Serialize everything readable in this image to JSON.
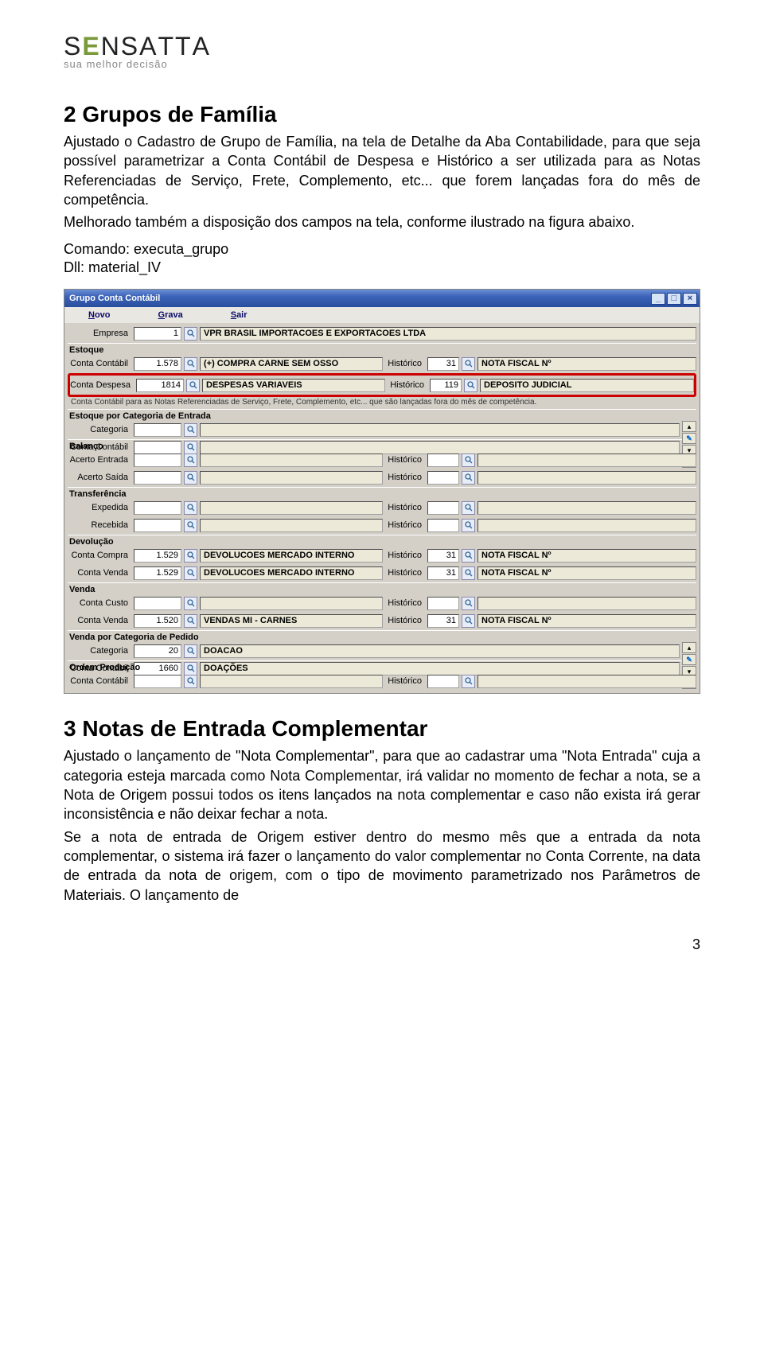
{
  "logo": {
    "brand": "SENSATTA",
    "tagline": "sua melhor decisão"
  },
  "section2": {
    "heading": "2  Grupos de Família",
    "p1": "Ajustado o Cadastro de Grupo de Família, na tela de Detalhe da Aba Contabilidade, para que seja possível parametrizar a Conta Contábil de Despesa e Histórico a ser utilizada para as Notas Referenciadas de Serviço, Frete, Complemento, etc... que forem lançadas fora do mês de competência.",
    "p2": "Melhorado também a disposição dos campos na tela, conforme ilustrado na figura abaixo.",
    "cmd": "Comando: executa_grupo",
    "dll": "Dll: material_IV"
  },
  "app": {
    "title": "Grupo Conta Contábil",
    "menu": {
      "novo": "Novo",
      "grava": "Grava",
      "sair": "Sair"
    },
    "empresa": {
      "label": "Empresa",
      "code": "1",
      "name": "VPR BRASIL IMPORTACOES E EXPORTACOES LTDA"
    },
    "estoque": {
      "title": "Estoque",
      "conta_label": "Conta Contábil",
      "conta_code": "1.578",
      "conta_name": "(+) COMPRA CARNE SEM OSSO",
      "hist_label": "Histórico",
      "hist_code": "31",
      "hist_name": "NOTA FISCAL Nº"
    },
    "despesa": {
      "label": "Conta Despesa",
      "code": "1814",
      "name": "DESPESAS VARIAVEIS",
      "hist_label": "Histórico",
      "hist_code": "119",
      "hist_name": "DEPOSITO JUDICIAL"
    },
    "note": "Conta Contábil para as Notas Referenciadas de Serviço, Frete, Complemento, etc... que são lançadas fora do mês de competência.",
    "estoque_cat": {
      "title": "Estoque por Categoria de Entrada",
      "categoria_label": "Categoria",
      "conta_label": "Conta Contábil"
    },
    "balanco": {
      "title": "Balanço",
      "entrada_label": "Acerto Entrada",
      "saida_label": "Acerto Saída",
      "hist_label": "Histórico"
    },
    "transf": {
      "title": "Transferência",
      "exp_label": "Expedida",
      "rec_label": "Recebida",
      "hist_label": "Histórico"
    },
    "devol": {
      "title": "Devolução",
      "compra_label": "Conta Compra",
      "compra_code": "1.529",
      "compra_name": "DEVOLUCOES MERCADO INTERNO",
      "venda_label": "Conta Venda",
      "venda_code": "1.529",
      "venda_name": "DEVOLUCOES MERCADO INTERNO",
      "hist_label": "Histórico",
      "hist_code": "31",
      "hist_name": "NOTA FISCAL Nº"
    },
    "venda": {
      "title": "Venda",
      "custo_label": "Conta Custo",
      "venda_label": "Conta Venda",
      "venda_code": "1.520",
      "venda_name": "VENDAS MI - CARNES",
      "hist_label": "Histórico",
      "hist_code": "31",
      "hist_name": "NOTA FISCAL Nº"
    },
    "venda_cat": {
      "title": "Venda por Categoria de Pedido",
      "categoria_label": "Categoria",
      "categoria_code": "20",
      "categoria_name": "DOACAO",
      "conta_label": "Conta Contábil",
      "conta_code": "1660",
      "conta_name": "DOAÇÕES"
    },
    "ordem": {
      "title": "Ordem Produção",
      "conta_label": "Conta Contábil",
      "hist_label": "Histórico"
    }
  },
  "section3": {
    "heading": "3  Notas de Entrada Complementar",
    "p1": "Ajustado o lançamento de \"Nota Complementar\", para que ao cadastrar uma \"Nota Entrada\" cuja a categoria esteja marcada como Nota Complementar, irá validar no momento de fechar a nota, se a Nota de Origem possui todos os itens lançados na nota complementar e caso não exista irá gerar inconsistência e não deixar fechar a nota.",
    "p2": "Se a nota de entrada de Origem estiver dentro do mesmo mês que a entrada da nota complementar, o sistema irá fazer o lançamento do valor complementar no Conta Corrente, na data de entrada da nota de origem, com o tipo de movimento parametrizado nos Parâmetros de Materiais. O lançamento de"
  },
  "page_num": "3"
}
